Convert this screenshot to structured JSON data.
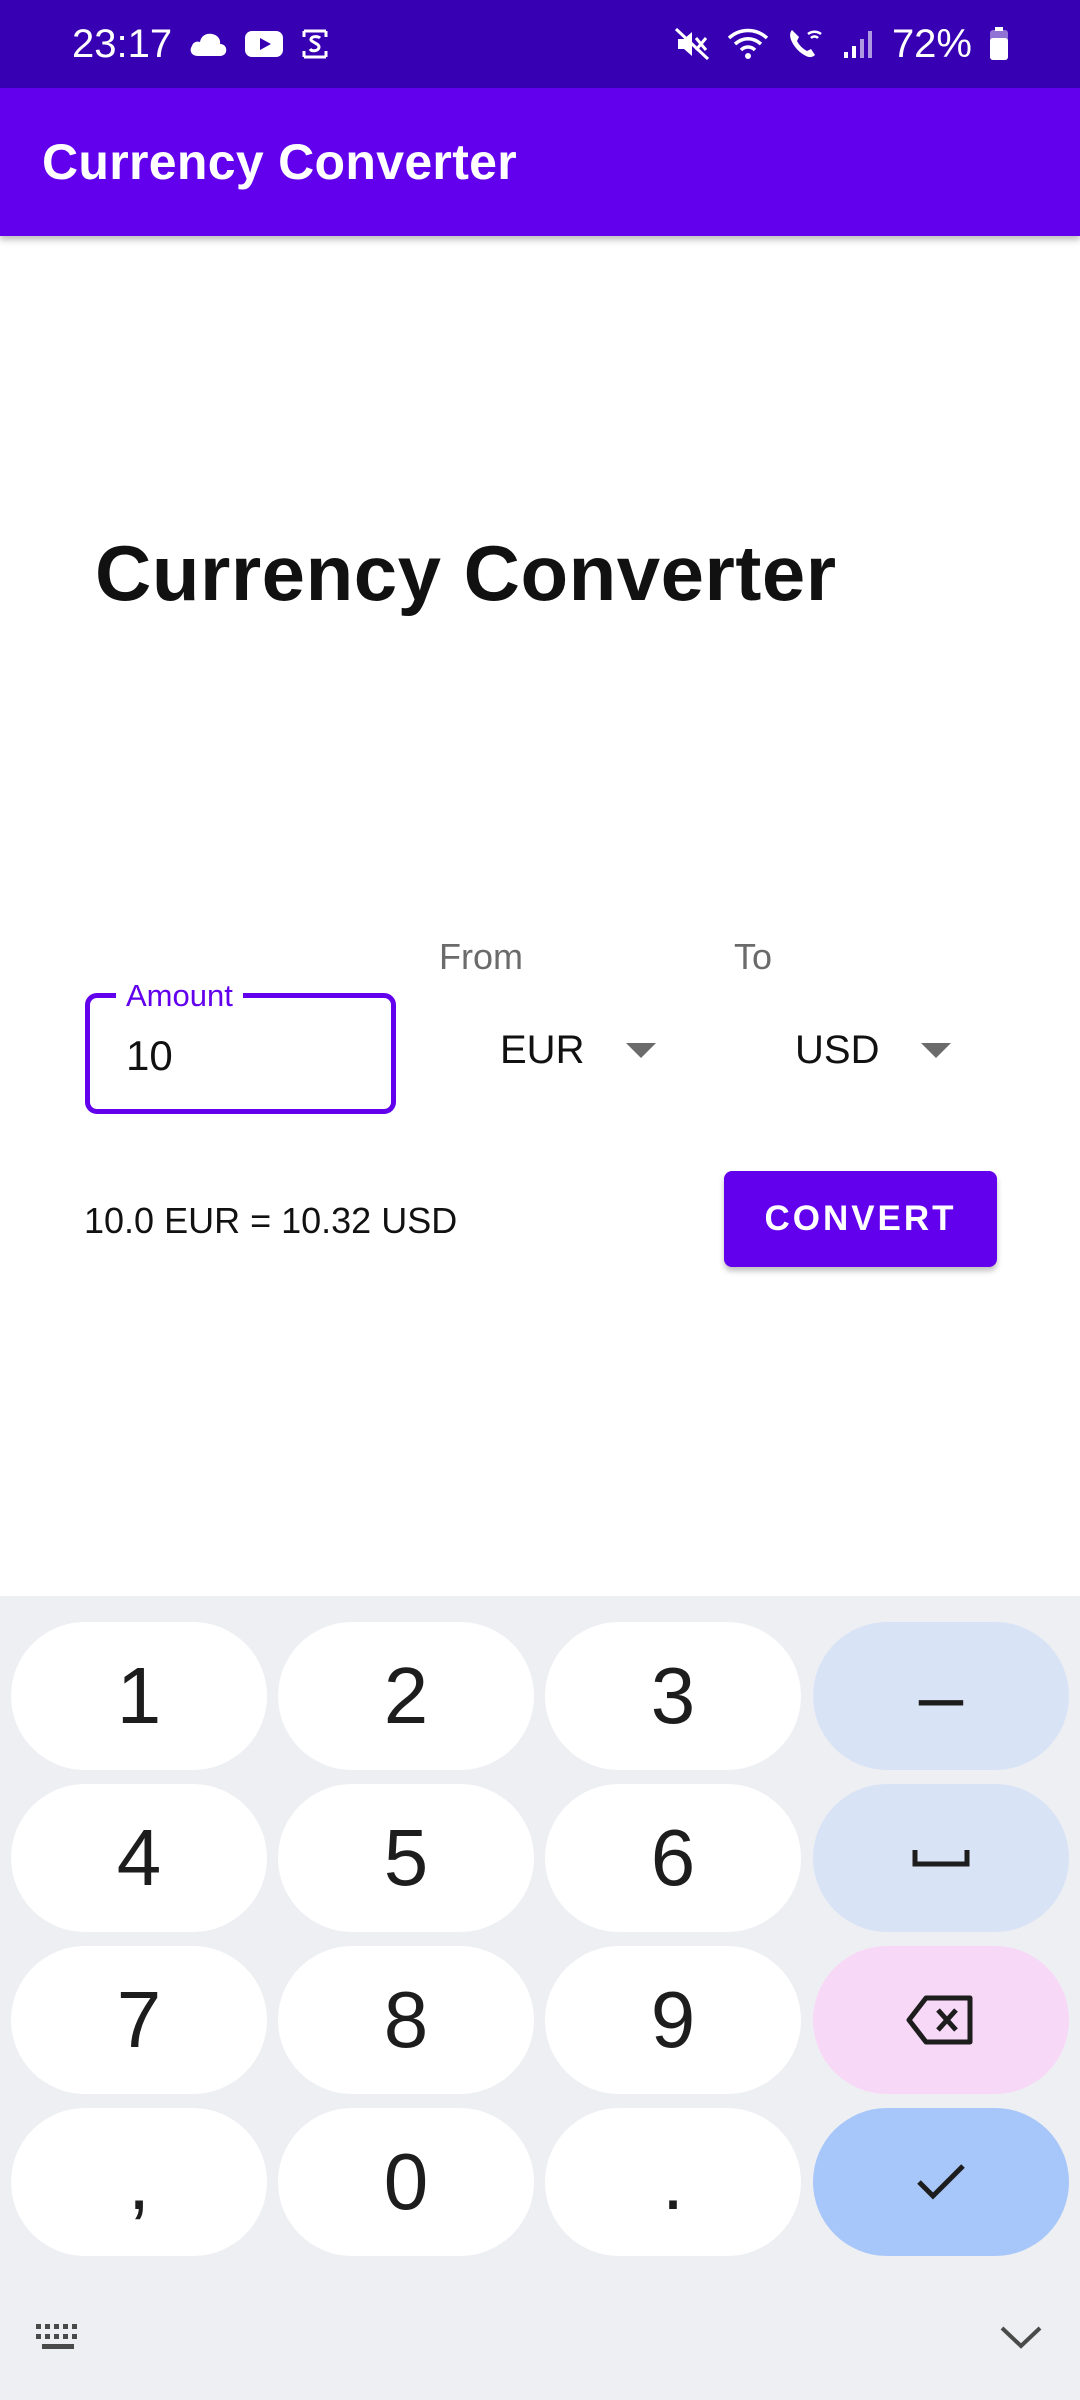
{
  "status_bar": {
    "time": "23:17",
    "battery": "72%",
    "left_icons": [
      "cloud-icon",
      "youtube-icon",
      "screen-record-icon"
    ],
    "right_icons": [
      "mute-icon",
      "wifi-icon",
      "wifi-call-icon",
      "signal-icon",
      "battery-icon"
    ]
  },
  "app_bar": {
    "title": "Currency Converter"
  },
  "main": {
    "heading": "Currency Converter",
    "amount_label": "Amount",
    "amount_value": "10",
    "from_label": "From",
    "from_value": "EUR",
    "to_label": "To",
    "to_value": "USD",
    "result": "10.0 EUR = 10.32 USD",
    "convert_label": "CONVERT"
  },
  "keyboard": {
    "keys": [
      "1",
      "2",
      "3",
      "–",
      "4",
      "5",
      "6",
      "7",
      "8",
      "9",
      ",",
      "0",
      "."
    ],
    "icons": [
      "space-icon",
      "backspace-icon",
      "check-icon",
      "keyboard-icon",
      "chevron-down-icon"
    ]
  },
  "colors": {
    "primary": "#6200ee",
    "primary_dark": "#3700b3"
  }
}
